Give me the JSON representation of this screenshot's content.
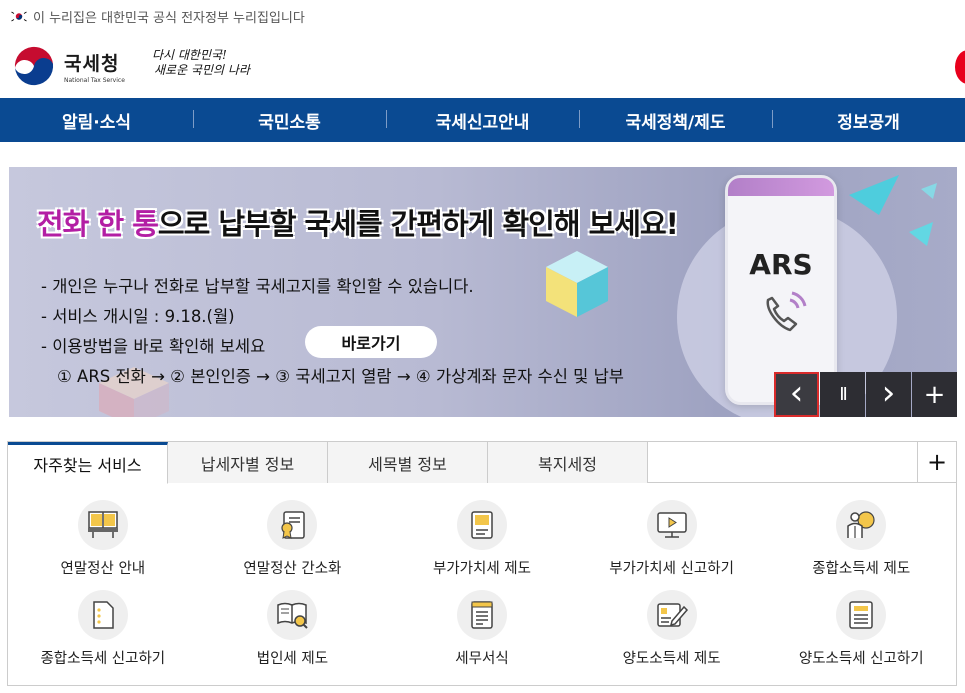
{
  "gov_banner": {
    "text": "이 누리집은 대한민국 공식 전자정부 누리집입니다"
  },
  "header": {
    "logo_ko": "국세청",
    "logo_en": "National Tax Service",
    "slogan_line1": "다시 대한민국!",
    "slogan_line2": "새로운 국민의 나라"
  },
  "nav": {
    "items": [
      {
        "label": "알림·소식"
      },
      {
        "label": "국민소통"
      },
      {
        "label": "국세신고안내"
      },
      {
        "label": "국세정책/제도"
      },
      {
        "label": "정보공개"
      }
    ]
  },
  "banner": {
    "headline_part1": "전화 한 통",
    "headline_part2": "으로 납부할 국세를 간편하게 확인해 보세요!",
    "bullet1": "- 개인은 누구나 전화로 납부할 국세고지를 확인할 수 있습니다.",
    "bullet2": "- 서비스 개시일 : 9.18.(월)",
    "bullet3": "- 이용방법을 바로 확인해 보세요",
    "goto_label": "바로가기",
    "steps": "① ARS 전화 → ② 본인인증 → ③ 국세고지 열람 → ④ 가상계좌 문자 수신 및 납부",
    "phone_text": "ARS",
    "controls": {
      "prev": "‹",
      "pause": "II",
      "next": "›",
      "plus": "+"
    }
  },
  "services": {
    "tabs": [
      {
        "label": "자주찾는 서비스"
      },
      {
        "label": "납세자별 정보"
      },
      {
        "label": "세목별 정보"
      },
      {
        "label": "복지세정"
      }
    ],
    "more": "+",
    "items": [
      {
        "label": "연말정산 안내",
        "icon": "open-book-icon"
      },
      {
        "label": "연말정산 간소화",
        "icon": "certificate-icon"
      },
      {
        "label": "부가가치세 제도",
        "icon": "book-icon"
      },
      {
        "label": "부가가치세 신고하기",
        "icon": "monitor-icon"
      },
      {
        "label": "종합소득세 제도",
        "icon": "person-bulb-icon"
      },
      {
        "label": "종합소득세 신고하기",
        "icon": "document-icon"
      },
      {
        "label": "법인세 제도",
        "icon": "book-search-icon"
      },
      {
        "label": "세무서식",
        "icon": "form-icon"
      },
      {
        "label": "양도소득세 제도",
        "icon": "pencil-doc-icon"
      },
      {
        "label": "양도소득세 신고하기",
        "icon": "list-doc-icon"
      }
    ]
  },
  "colors": {
    "nav_bg": "#0a4a92",
    "accent_pink": "#b31ea4",
    "brand_red": "#e8001c"
  }
}
